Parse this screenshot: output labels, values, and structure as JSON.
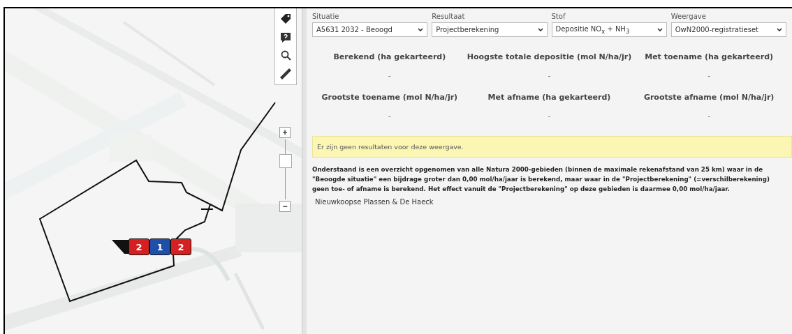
{
  "map": {
    "kind": "picture",
    "zoom": {
      "in": "+",
      "out": "−"
    },
    "markers": [
      {
        "label": "2",
        "color": "#d42020"
      },
      {
        "label": "1",
        "color": "#1f4fa8"
      },
      {
        "label": "2",
        "color": "#d42020"
      }
    ]
  },
  "filters": [
    {
      "label": "Situatie",
      "value": "A5631 2032 - Beoogd"
    },
    {
      "label": "Resultaat",
      "value": "Projectberekening"
    },
    {
      "label": "Stof",
      "value": "Depositie NO$_{x}$ + NH$_{3}$"
    },
    {
      "label": "Weergave",
      "value": "OwN2000-registratieset"
    }
  ],
  "stats": [
    {
      "title": "Berekend (ha gekarteerd)",
      "value": "-"
    },
    {
      "title": "Hoogste totale depositie (mol N/ha/jr)",
      "value": "-"
    },
    {
      "title": "Met toename (ha gekarteerd)",
      "value": "-"
    },
    {
      "title": "Grootste toename (mol N/ha/jr)",
      "value": "-"
    },
    {
      "title": "Met afname (ha gekarteerd)",
      "value": "-"
    },
    {
      "title": "Grootste afname (mol N/ha/jr)",
      "value": "-"
    }
  ],
  "notice": "Er zijn geen resultaten voor deze weergave.",
  "explanation": "Onderstaand is een overzicht opgenomen van alle Natura 2000-gebieden (binnen de maximale rekenafstand van 25 km) waar in de \"Beoogde situatie\" een bijdrage groter dan 0,00 mol/ha/jaar is berekend, maar waar in de \"Projectberekening\" (=verschilberekening) geen toe- of afname is berekend. Het effect vanuit de \"Projectberekening\" op deze gebieden is daarmee 0,00 mol/ha/jaar.",
  "areas": [
    "Nieuwkoopse Plassen & De Haeck"
  ]
}
